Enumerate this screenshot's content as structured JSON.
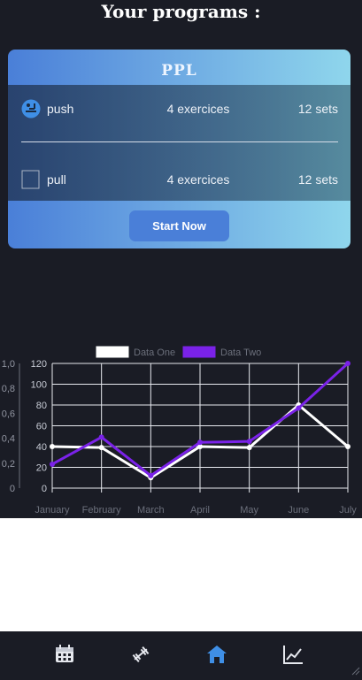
{
  "page": {
    "title": "Your programs :"
  },
  "program": {
    "name": "PPL",
    "rows": [
      {
        "name": "push",
        "exercises": "4 exercices",
        "sets": "12 sets",
        "icon": "bench-press-icon"
      },
      {
        "name": "pull",
        "exercises": "4 exercices",
        "sets": "12 sets",
        "icon": "empty-square-icon"
      }
    ],
    "start_label": "Start Now"
  },
  "chart_data": {
    "type": "line",
    "categories": [
      "January",
      "February",
      "March",
      "April",
      "May",
      "June",
      "July"
    ],
    "series": [
      {
        "name": "Data One",
        "values": [
          40,
          39,
          10,
          40,
          39,
          80,
          40
        ],
        "color": "#ffffff"
      },
      {
        "name": "Data Two",
        "values": [
          23,
          49,
          12,
          44,
          45,
          77,
          120
        ],
        "color": "#7a22e8"
      }
    ],
    "y_left_ticks": [
      "1,0",
      "0,8",
      "0,6",
      "0,4",
      "0,2",
      "0"
    ],
    "y_right_ticks": [
      "120",
      "100",
      "80",
      "60",
      "40",
      "20",
      "0"
    ],
    "ylim": [
      0,
      120
    ],
    "grid": true,
    "legend_position": "top-center"
  },
  "nav": {
    "items": [
      {
        "name": "calendar",
        "icon": "calendar-icon"
      },
      {
        "name": "workouts",
        "icon": "dumbbell-icon"
      },
      {
        "name": "home",
        "icon": "home-icon",
        "active": true
      },
      {
        "name": "progress",
        "icon": "line-chart-icon"
      }
    ],
    "active_color": "#3f8fe6"
  }
}
